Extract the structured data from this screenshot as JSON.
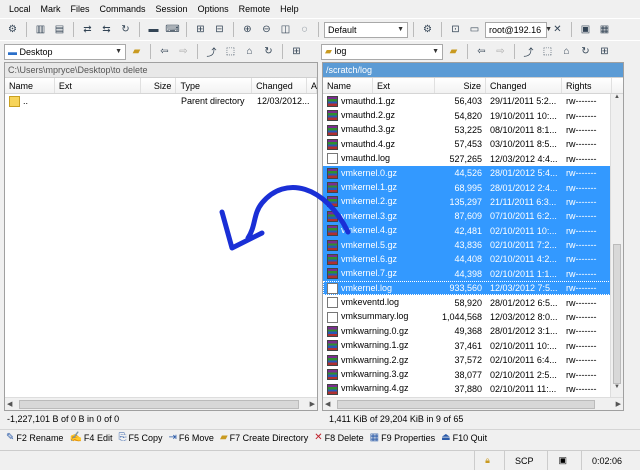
{
  "menu": [
    "Local",
    "Mark",
    "Files",
    "Commands",
    "Session",
    "Options",
    "Remote",
    "Help"
  ],
  "toolbar": {
    "transfer_profile": "Default",
    "session": "root@192.16"
  },
  "left_nav": {
    "location": "Desktop"
  },
  "right_nav": {
    "location": "log"
  },
  "left_panel": {
    "path": "C:\\Users\\mpryce\\Desktop\\to delete",
    "columns": [
      "Name",
      "Ext",
      "Size",
      "Type",
      "Changed",
      "A"
    ],
    "rows": [
      {
        "name": "..",
        "ext": "",
        "size": "",
        "type": "Parent directory",
        "changed": "12/03/2012..."
      }
    ],
    "status": "-1,227,101 B of 0 B in 0 of 0"
  },
  "right_panel": {
    "path": "/scratch/log",
    "columns": [
      "Name",
      "Ext",
      "Size",
      "Changed",
      "Rights"
    ],
    "rows": [
      {
        "name": "vmauthd.1.gz",
        "size": "56,403",
        "changed": "29/11/2011 5:2...",
        "rights": "rw-------",
        "kind": "gz",
        "selected": false
      },
      {
        "name": "vmauthd.2.gz",
        "size": "54,820",
        "changed": "19/10/2011 10:...",
        "rights": "rw-------",
        "kind": "gz",
        "selected": false
      },
      {
        "name": "vmauthd.3.gz",
        "size": "53,225",
        "changed": "08/10/2011 8:1...",
        "rights": "rw-------",
        "kind": "gz",
        "selected": false
      },
      {
        "name": "vmauthd.4.gz",
        "size": "57,453",
        "changed": "03/10/2011 8:5...",
        "rights": "rw-------",
        "kind": "gz",
        "selected": false
      },
      {
        "name": "vmauthd.log",
        "size": "527,265",
        "changed": "12/03/2012 4:4...",
        "rights": "rw-------",
        "kind": "log",
        "selected": false
      },
      {
        "name": "vmkernel.0.gz",
        "size": "44,526",
        "changed": "28/01/2012 5:4...",
        "rights": "rw-------",
        "kind": "gz",
        "selected": true
      },
      {
        "name": "vmkernel.1.gz",
        "size": "68,995",
        "changed": "28/01/2012 2:4...",
        "rights": "rw-------",
        "kind": "gz",
        "selected": true
      },
      {
        "name": "vmkernel.2.gz",
        "size": "135,297",
        "changed": "21/11/2011 6:3...",
        "rights": "rw-------",
        "kind": "gz",
        "selected": true
      },
      {
        "name": "vmkernel.3.gz",
        "size": "87,609",
        "changed": "07/10/2011 6:2...",
        "rights": "rw-------",
        "kind": "gz",
        "selected": true
      },
      {
        "name": "vmkernel.4.gz",
        "size": "42,481",
        "changed": "02/10/2011 10:...",
        "rights": "rw-------",
        "kind": "gz",
        "selected": true
      },
      {
        "name": "vmkernel.5.gz",
        "size": "43,836",
        "changed": "02/10/2011 7:2...",
        "rights": "rw-------",
        "kind": "gz",
        "selected": true
      },
      {
        "name": "vmkernel.6.gz",
        "size": "44,408",
        "changed": "02/10/2011 4:2...",
        "rights": "rw-------",
        "kind": "gz",
        "selected": true
      },
      {
        "name": "vmkernel.7.gz",
        "size": "44,398",
        "changed": "02/10/2011 1:1...",
        "rights": "rw-------",
        "kind": "gz",
        "selected": true
      },
      {
        "name": "vmkernel.log",
        "size": "933,560",
        "changed": "12/03/2012 7:5...",
        "rights": "rw-------",
        "kind": "log",
        "selected": true
      },
      {
        "name": "vmkeventd.log",
        "size": "58,920",
        "changed": "28/01/2012 6:5...",
        "rights": "rw-------",
        "kind": "log",
        "selected": false
      },
      {
        "name": "vmksummary.log",
        "size": "1,044,568",
        "changed": "12/03/2012 8:0...",
        "rights": "rw-------",
        "kind": "log",
        "selected": false
      },
      {
        "name": "vmkwarning.0.gz",
        "size": "49,368",
        "changed": "28/01/2012 3:1...",
        "rights": "rw-------",
        "kind": "gz",
        "selected": false
      },
      {
        "name": "vmkwarning.1.gz",
        "size": "37,461",
        "changed": "02/10/2011 10:...",
        "rights": "rw-------",
        "kind": "gz",
        "selected": false
      },
      {
        "name": "vmkwarning.2.gz",
        "size": "37,572",
        "changed": "02/10/2011 6:4...",
        "rights": "rw-------",
        "kind": "gz",
        "selected": false
      },
      {
        "name": "vmkwarning.3.gz",
        "size": "38,077",
        "changed": "02/10/2011 2:5...",
        "rights": "rw-------",
        "kind": "gz",
        "selected": false
      },
      {
        "name": "vmkwarning.4.gz",
        "size": "37,880",
        "changed": "02/10/2011 11:...",
        "rights": "rw-------",
        "kind": "gz",
        "selected": false
      }
    ],
    "status": "1,411 KiB of 29,204 KiB in 9 of 65"
  },
  "fkeys": [
    {
      "key": "F2",
      "label": "Rename",
      "icon": "rename-icon"
    },
    {
      "key": "F4",
      "label": "Edit",
      "icon": "edit-icon"
    },
    {
      "key": "F5",
      "label": "Copy",
      "icon": "copy-icon"
    },
    {
      "key": "F6",
      "label": "Move",
      "icon": "move-icon"
    },
    {
      "key": "F7",
      "label": "Create Directory",
      "icon": "folder-add-icon"
    },
    {
      "key": "F8",
      "label": "Delete",
      "icon": "delete-icon"
    },
    {
      "key": "F9",
      "label": "Properties",
      "icon": "properties-icon"
    },
    {
      "key": "F10",
      "label": "Quit",
      "icon": "quit-icon"
    }
  ],
  "bottom_status": {
    "protocol": "SCP",
    "elapsed": "0:02:06"
  },
  "colors": {
    "selection": "#3399ff",
    "path_active": "#5b9bd5",
    "annotation_arrow": "#1a2fd6"
  }
}
